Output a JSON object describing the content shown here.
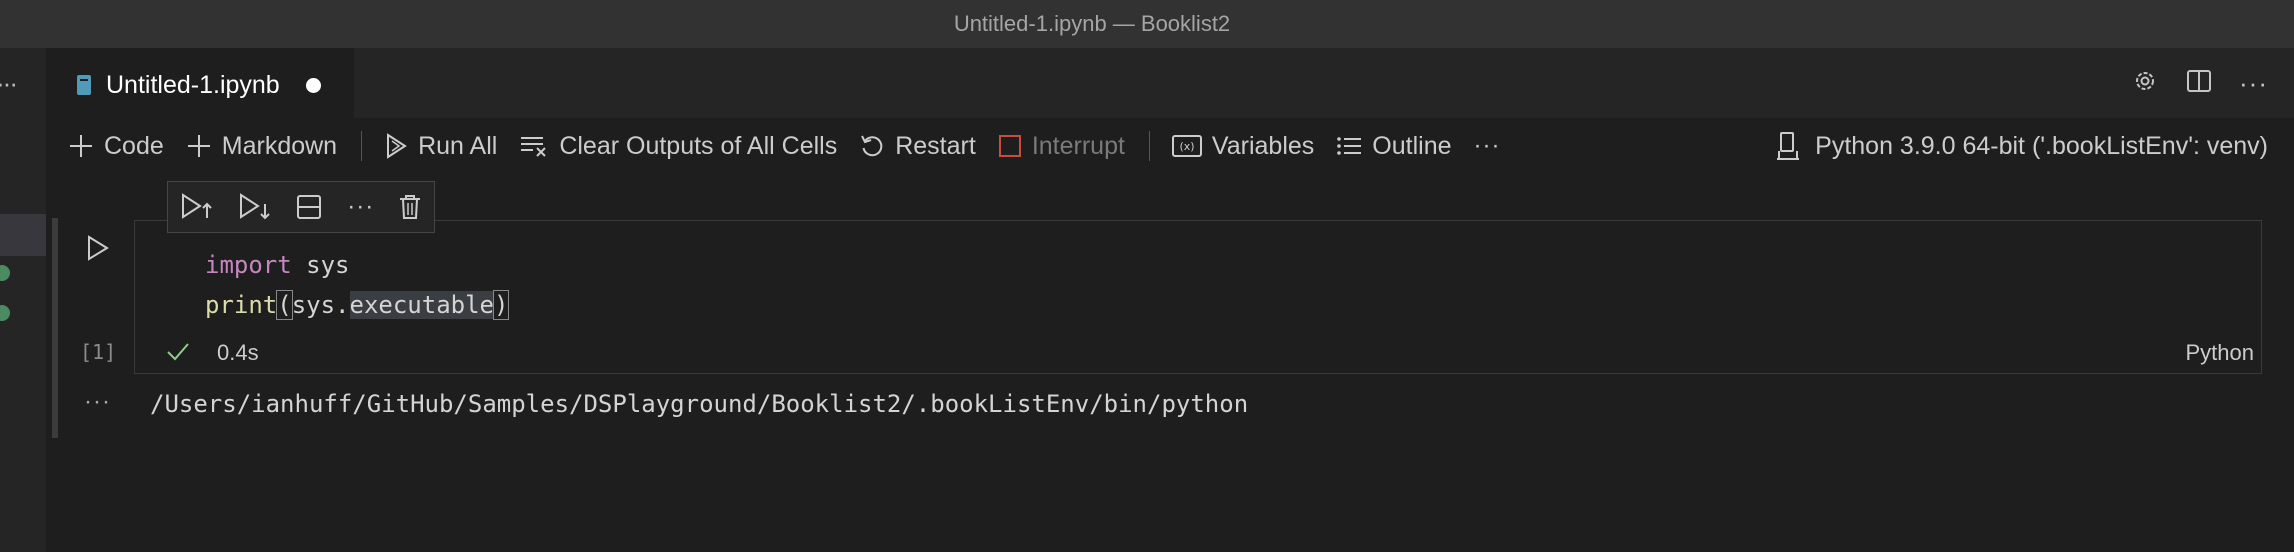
{
  "window": {
    "title": "Untitled-1.ipynb — Booklist2"
  },
  "tab": {
    "label": "Untitled-1.ipynb"
  },
  "toolbar": {
    "code": "Code",
    "markdown": "Markdown",
    "run_all": "Run All",
    "clear_outputs": "Clear Outputs of All Cells",
    "restart": "Restart",
    "interrupt": "Interrupt",
    "variables": "Variables",
    "outline": "Outline",
    "more": "···",
    "kernel": "Python 3.9.0 64-bit ('.bookListEnv': venv)"
  },
  "cell": {
    "line1_kw": "import",
    "line1_rest": " sys",
    "line2_fn": "print",
    "line2_open": "(",
    "line2_obj": "sys.",
    "line2_attr": "executable",
    "line2_close": ")",
    "execution_count": "[1]",
    "duration": "0.4s",
    "language": "Python",
    "output": "/Users/ianhuff/GitHub/Samples/DSPlayground/Booklist2/.bookListEnv/bin/python",
    "output_dots": "···"
  },
  "colors": {
    "background": "#1e1e1e",
    "keyword": "#c586c0",
    "function": "#dcdcaa",
    "success": "#89d185",
    "interrupt": "#c74e39",
    "modified_dot": "#4c8a61"
  }
}
